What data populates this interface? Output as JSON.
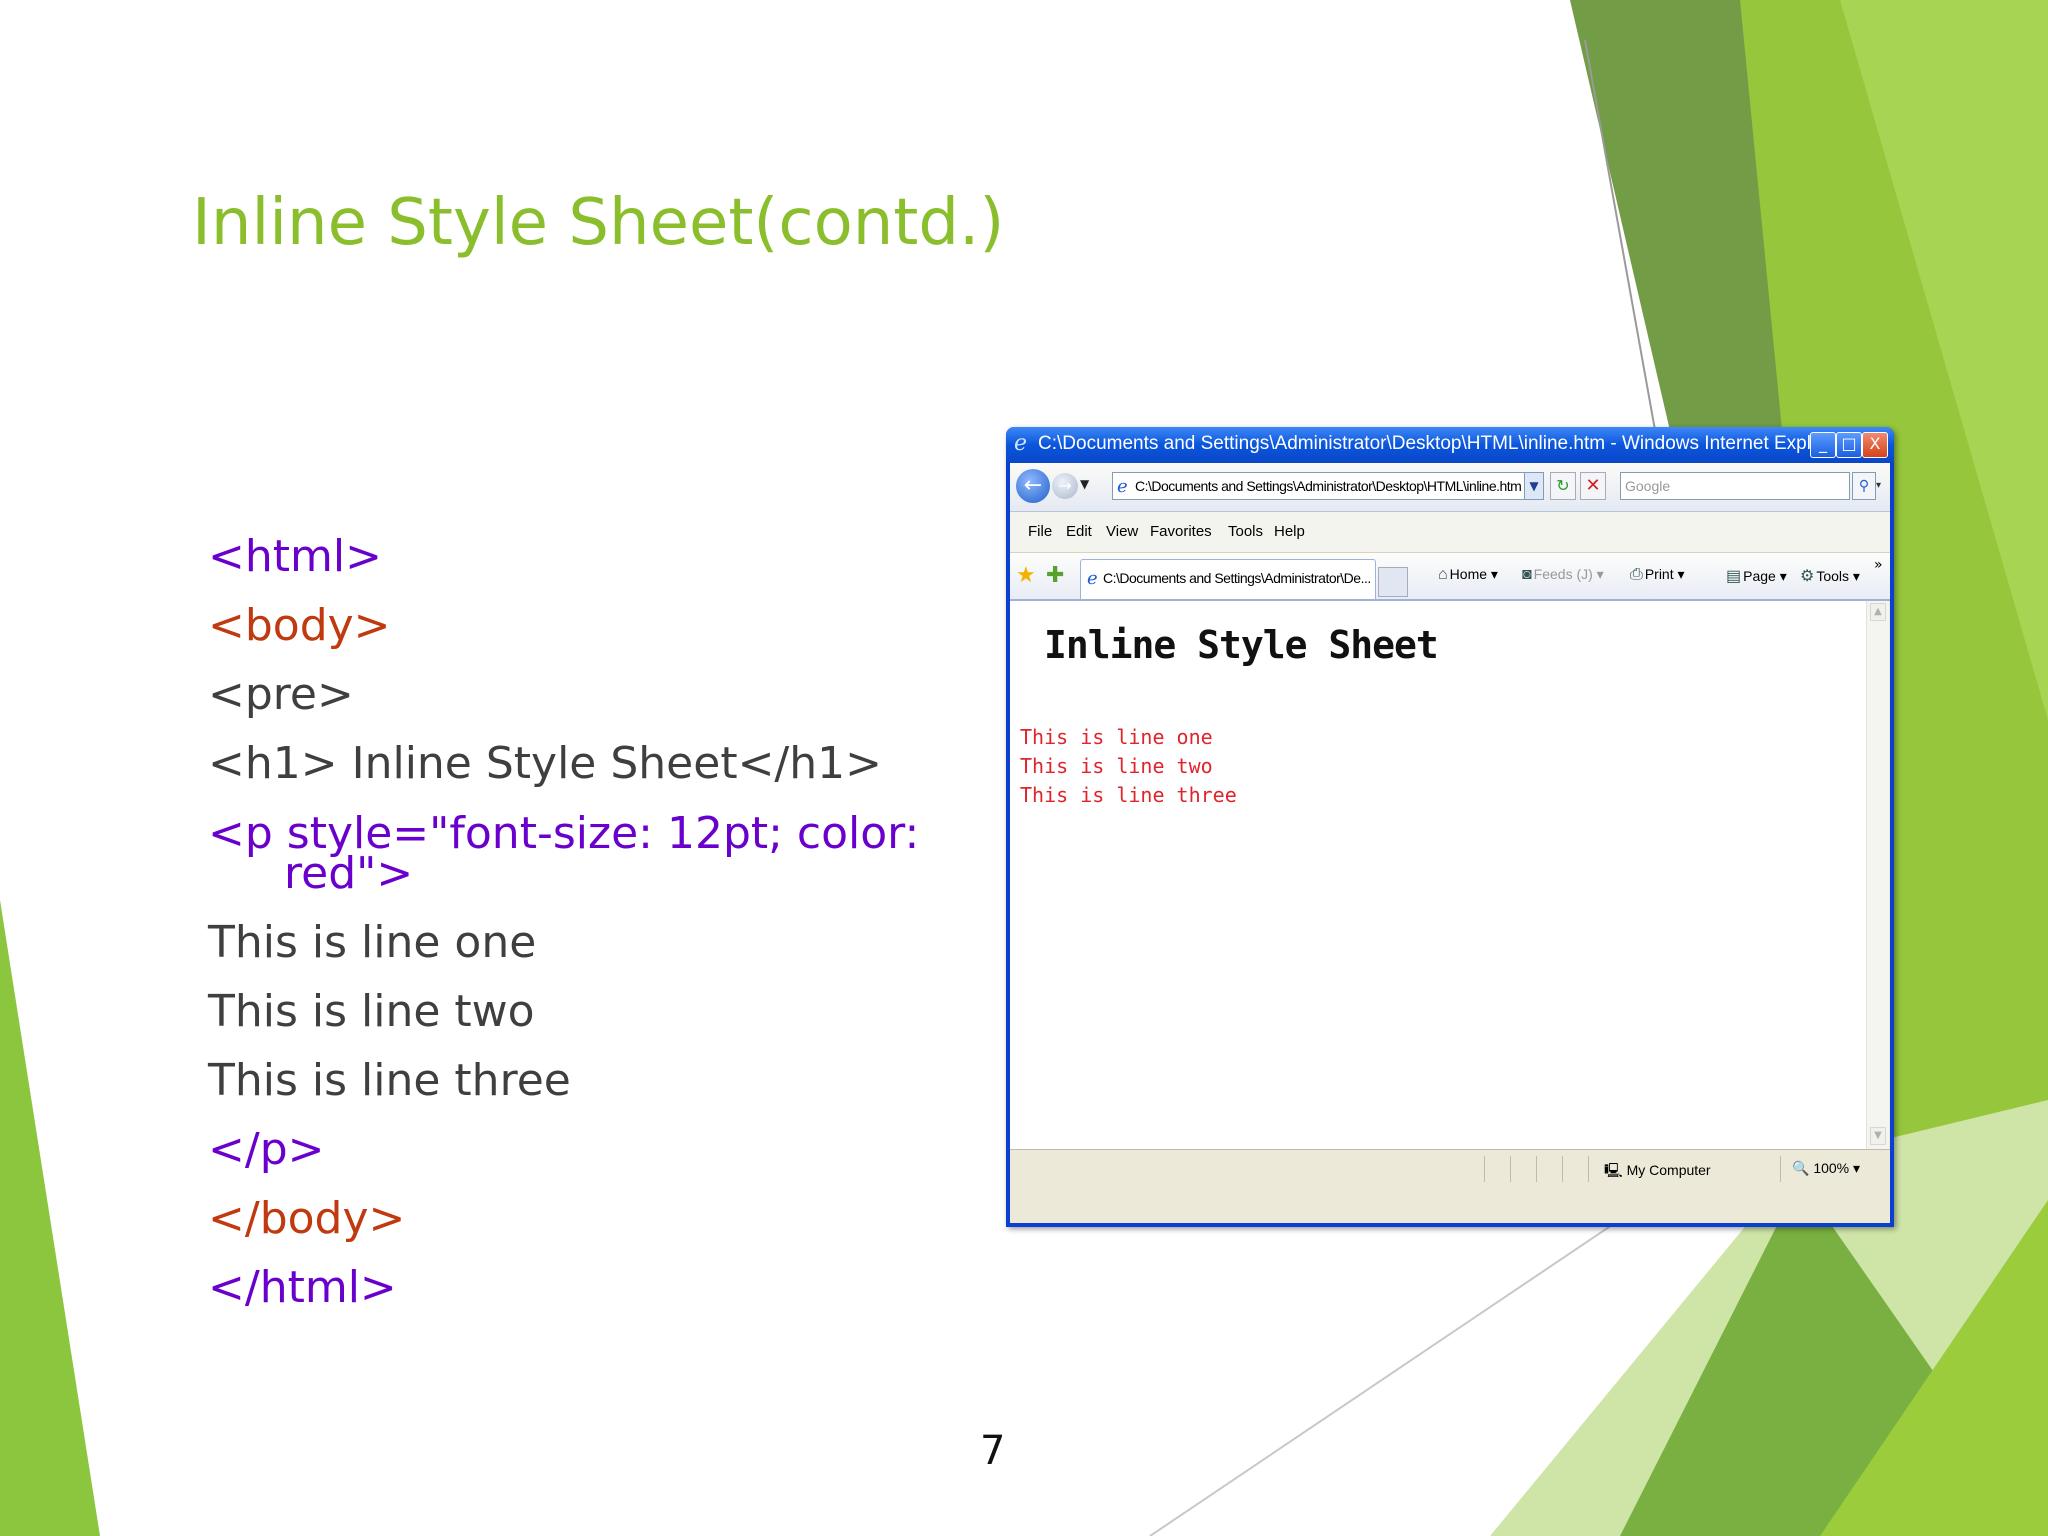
{
  "slide": {
    "title": "Inline Style Sheet(contd.)",
    "page_number": "7",
    "colors": {
      "title": "#8bbe2d",
      "tag_purple": "#6a00cc",
      "tag_orange": "#c0390f",
      "plain_text": "#3f3f3f",
      "accent_green_light": "#9bcc3c",
      "accent_green_dark": "#6e9b3e"
    }
  },
  "code": {
    "lines": [
      "<html>",
      "<body>",
      "<pre>",
      "<h1> Inline Style Sheet</h1>",
      "<p style=\"font-size: 12pt; color: red\">",
      "This is line one",
      "This is line two",
      "This is line three",
      "</p>",
      "</body>",
      "</html>"
    ]
  },
  "browser": {
    "title": "C:\\Documents and Settings\\Administrator\\Desktop\\HTML\\inline.htm - Windows Internet Explorer",
    "window_buttons": {
      "minimize": "_",
      "maximize": "□",
      "close": "X"
    },
    "address": "C:\\Documents and Settings\\Administrator\\Desktop\\HTML\\inline.htm",
    "search_placeholder": "Google",
    "menu": [
      "File",
      "Edit",
      "View",
      "Favorites",
      "Tools",
      "Help"
    ],
    "tab_label": "C:\\Documents and Settings\\Administrator\\De...",
    "commands": {
      "home": "Home",
      "feeds": "Feeds (J)",
      "print": "Print",
      "page": "Page",
      "tools": "Tools",
      "more": "»"
    },
    "page": {
      "h1": "Inline Style Sheet",
      "lines": [
        "This is line one",
        "This is line two",
        "This is line three"
      ]
    },
    "status": {
      "zone": "My Computer",
      "zoom": "100%"
    },
    "icons": [
      "ie-logo-icon",
      "back-icon",
      "forward-icon",
      "refresh-icon",
      "stop-icon",
      "search-icon",
      "favorites-star-icon",
      "add-favorites-icon",
      "home-icon",
      "feeds-icon",
      "print-icon",
      "page-icon",
      "tools-gear-icon",
      "computer-icon",
      "zoom-icon"
    ]
  }
}
